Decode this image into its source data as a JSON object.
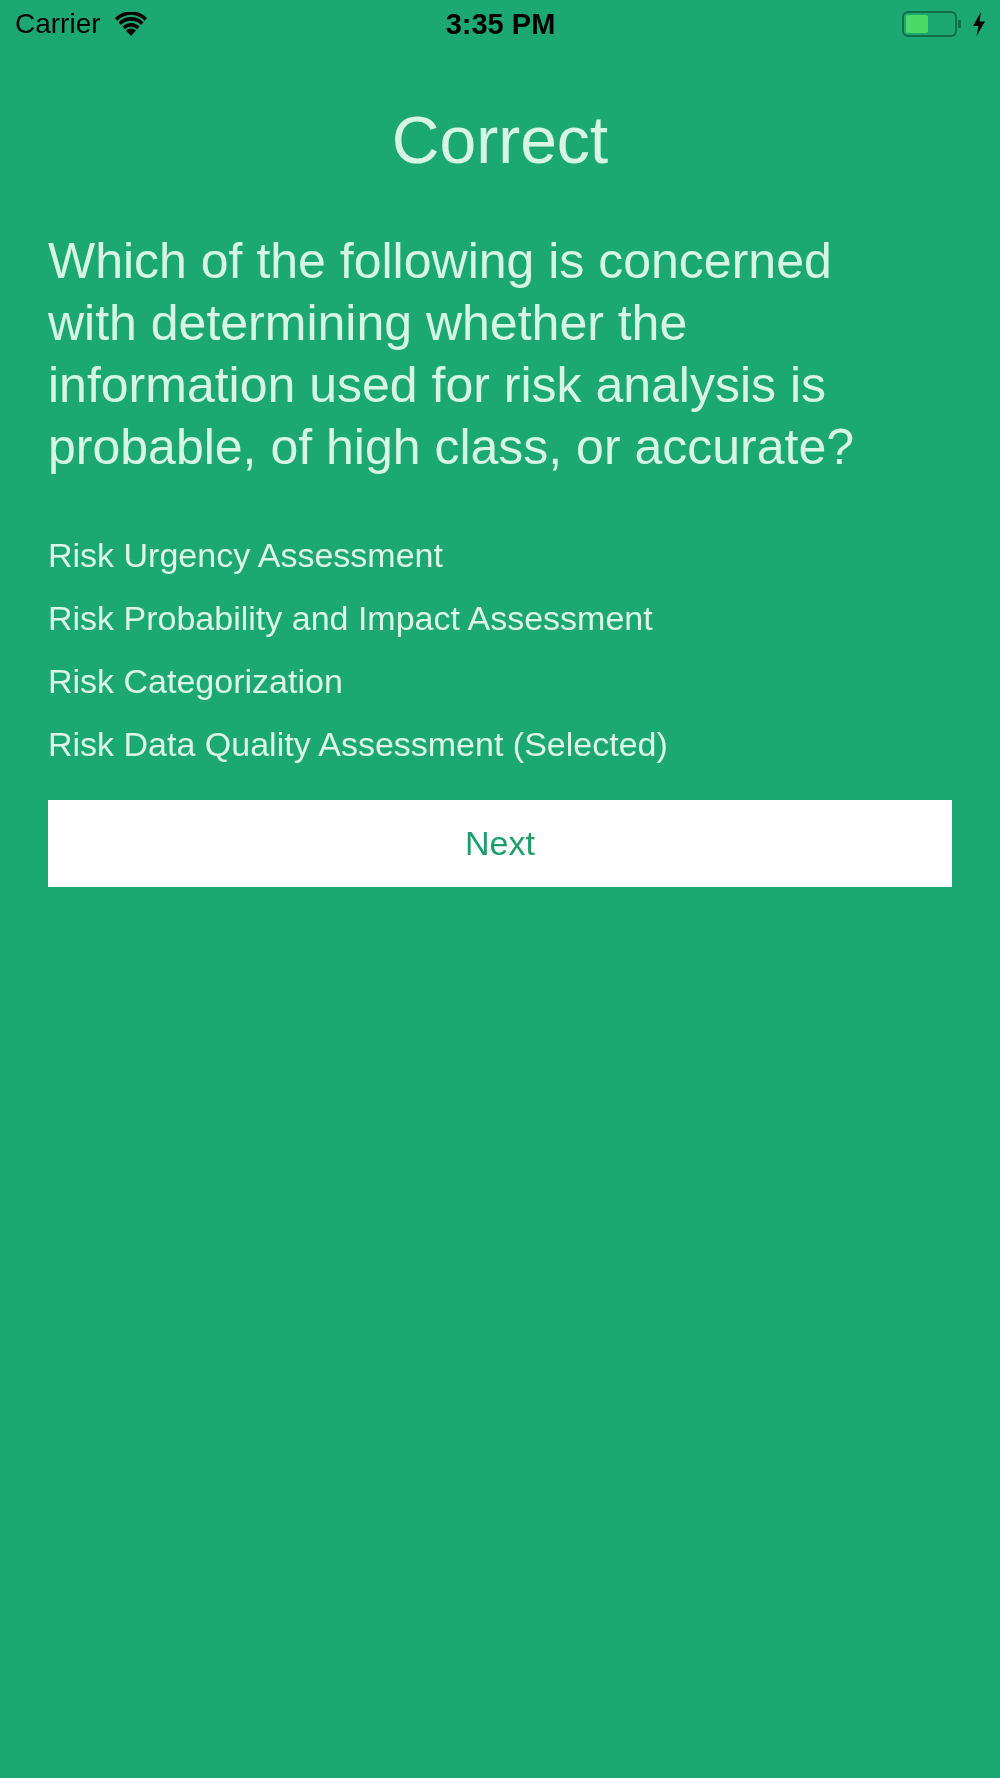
{
  "status_bar": {
    "carrier": "Carrier",
    "time": "3:35 PM"
  },
  "result": {
    "title": "Correct"
  },
  "question": {
    "text": "Which of the following is concerned with determining whether the information used for risk analysis is probable, of high class, or accurate?"
  },
  "options": [
    {
      "label": "Risk Urgency Assessment"
    },
    {
      "label": "Risk Probability and Impact Assessment"
    },
    {
      "label": "Risk Categorization"
    },
    {
      "label": "Risk Data Quality Assessment (Selected)"
    }
  ],
  "next_button": {
    "label": "Next"
  }
}
